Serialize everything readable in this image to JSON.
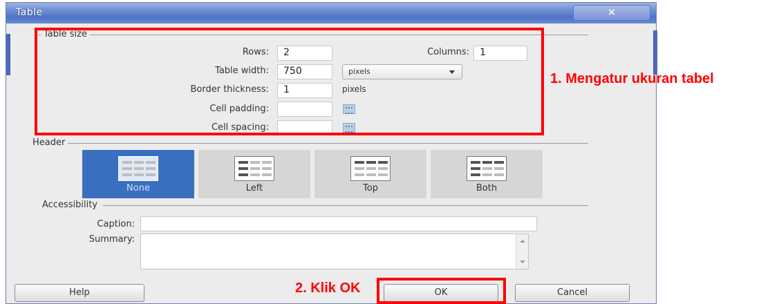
{
  "window": {
    "title": "Table",
    "close_glyph": "✕"
  },
  "table_size": {
    "legend": "Table size",
    "rows_label": "Rows:",
    "rows_value": "2",
    "columns_label": "Columns:",
    "columns_value": "1",
    "width_label": "Table width:",
    "width_value": "750",
    "width_unit": "pixels",
    "border_label": "Border thickness:",
    "border_value": "1",
    "border_unit": "pixels",
    "padding_label": "Cell padding:",
    "padding_value": "",
    "spacing_label": "Cell spacing:",
    "spacing_value": ""
  },
  "header": {
    "legend": "Header",
    "options": [
      {
        "label": "None",
        "selected": true
      },
      {
        "label": "Left",
        "selected": false
      },
      {
        "label": "Top",
        "selected": false
      },
      {
        "label": "Both",
        "selected": false
      }
    ]
  },
  "accessibility": {
    "legend": "Accessibility",
    "caption_label": "Caption:",
    "caption_value": "",
    "summary_label": "Summary:",
    "summary_value": ""
  },
  "buttons": {
    "help": "Help",
    "ok": "OK",
    "cancel": "Cancel"
  },
  "annotations": {
    "table_size_note": "1. Mengatur ukuran tabel",
    "ok_note": "2. Klik OK",
    "color": "#ff0000"
  },
  "colors": {
    "selected_header": "#3a6fc0",
    "titlebar": "#4e73c4"
  }
}
